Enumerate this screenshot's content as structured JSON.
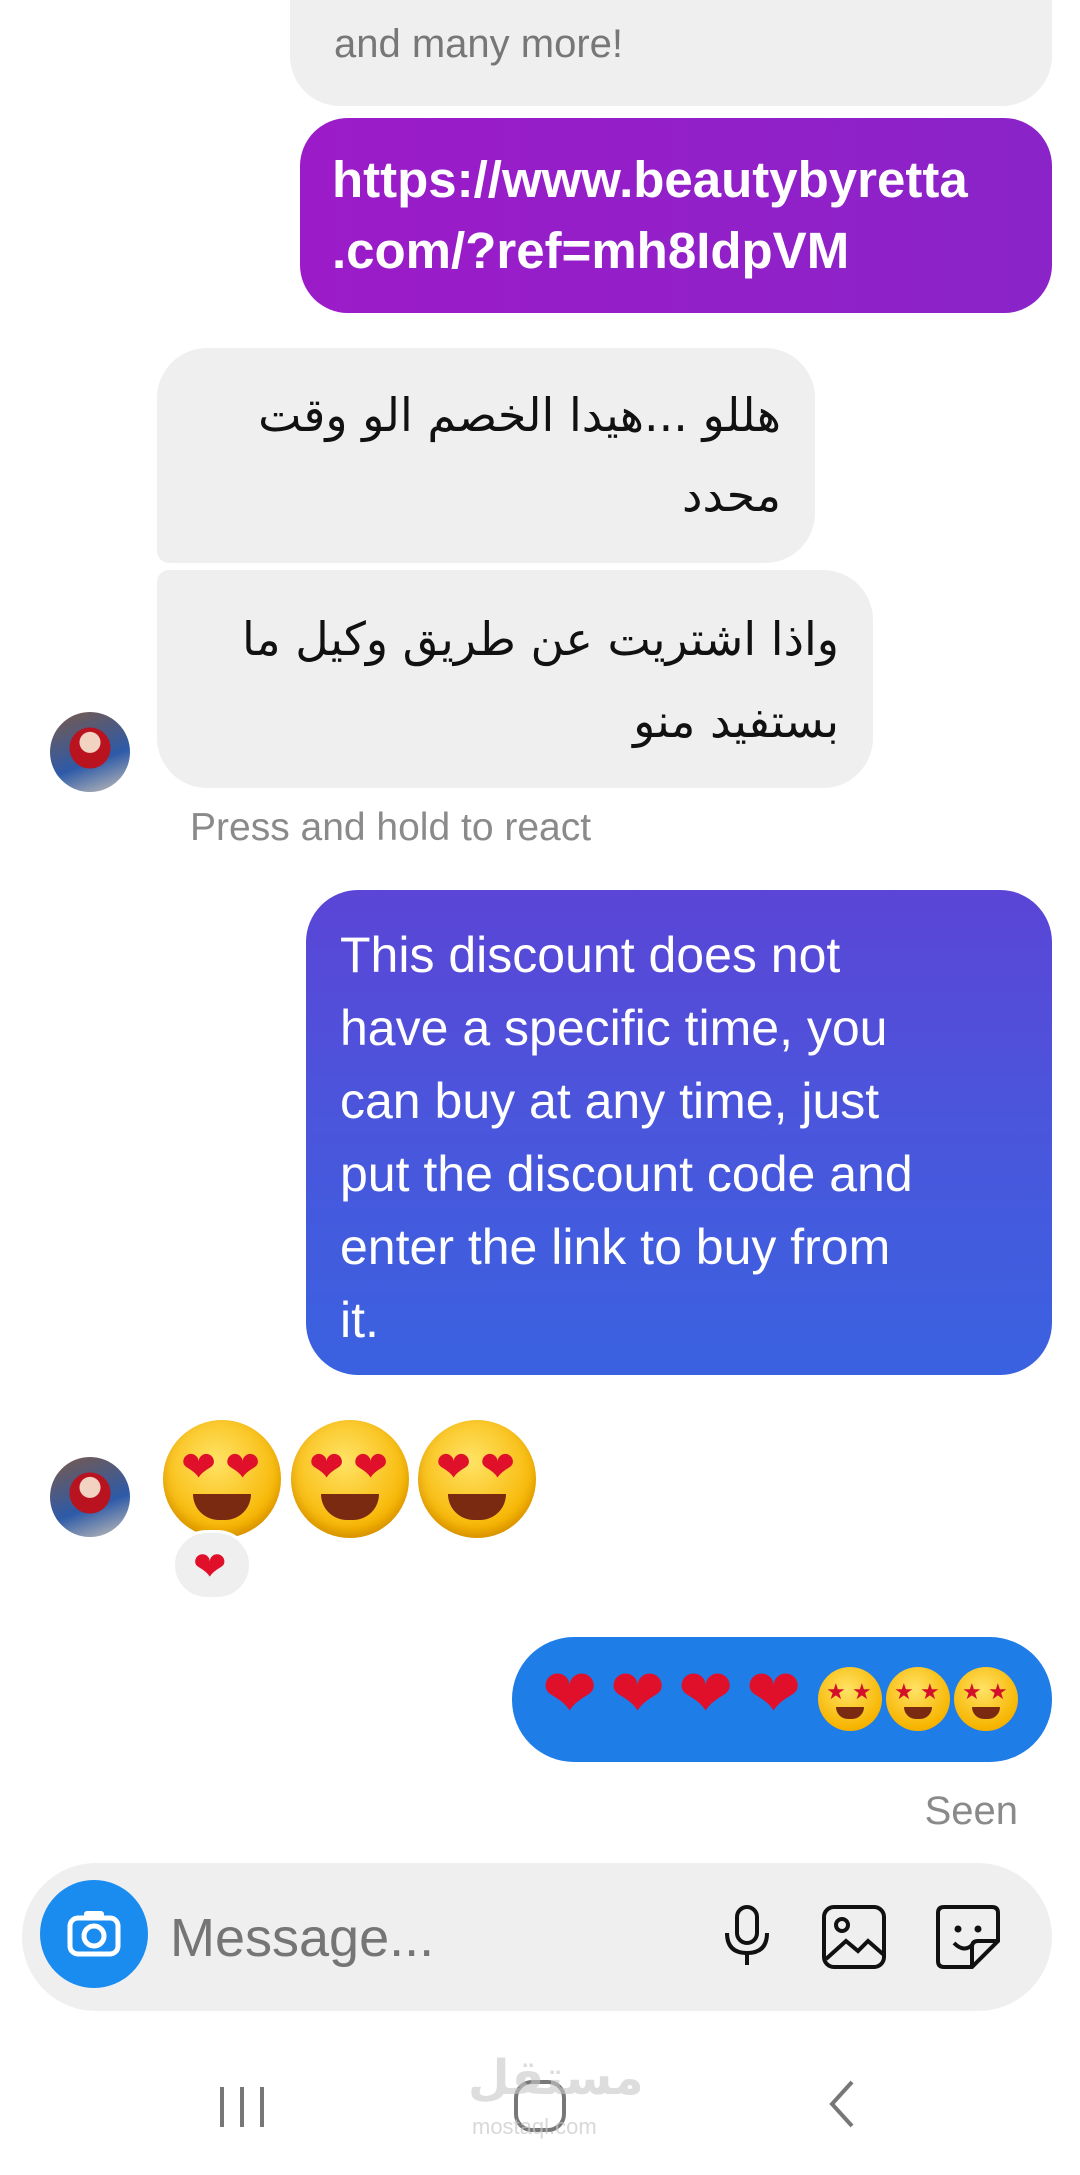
{
  "messages": {
    "partial_top": "and many more!",
    "link": "https://www.beautybyretta.com/?ref=mh8IdpVM",
    "link_line1": "https://www.beautybyretta",
    "link_line2": ".com/?ref=mh8IdpVM",
    "arabic1_line1": "هللو ...هيدا الخصم الو وقت",
    "arabic1_line2": "محدد",
    "arabic2_line1": "واذا اشتريت عن طريق وكيل ما",
    "arabic2_line2": "بستفيد منو",
    "react_hint": "Press and hold to react",
    "reply_lines": [
      "This discount does not",
      "have a specific time, you",
      "can buy at any time, just",
      "put the discount code and",
      "enter the link to buy from",
      "it."
    ],
    "incoming_emojis": [
      "heart-eyes",
      "heart-eyes",
      "heart-eyes"
    ],
    "reaction": "heart",
    "outgoing_emojis": [
      "heart",
      "heart",
      "heart",
      "heart",
      "star-struck",
      "star-struck",
      "star-struck"
    ],
    "seen": "Seen"
  },
  "composer": {
    "placeholder": "Message...",
    "icons": [
      "camera-icon",
      "microphone-icon",
      "gallery-icon",
      "sticker-icon"
    ]
  },
  "navbar": {
    "icons": [
      "recents-icon",
      "home-icon",
      "back-icon"
    ],
    "watermark": "مستقل",
    "watermark_sub": "mostaql.com"
  },
  "colors": {
    "link_bubble": "#8c1ec8",
    "reply_bubble_top": "#5b4ed6",
    "reply_bubble_bottom": "#3a61e0",
    "emoji_bubble": "#1f7de8",
    "incoming_bubble": "#efefef",
    "camera_button": "#1a8cf0"
  }
}
